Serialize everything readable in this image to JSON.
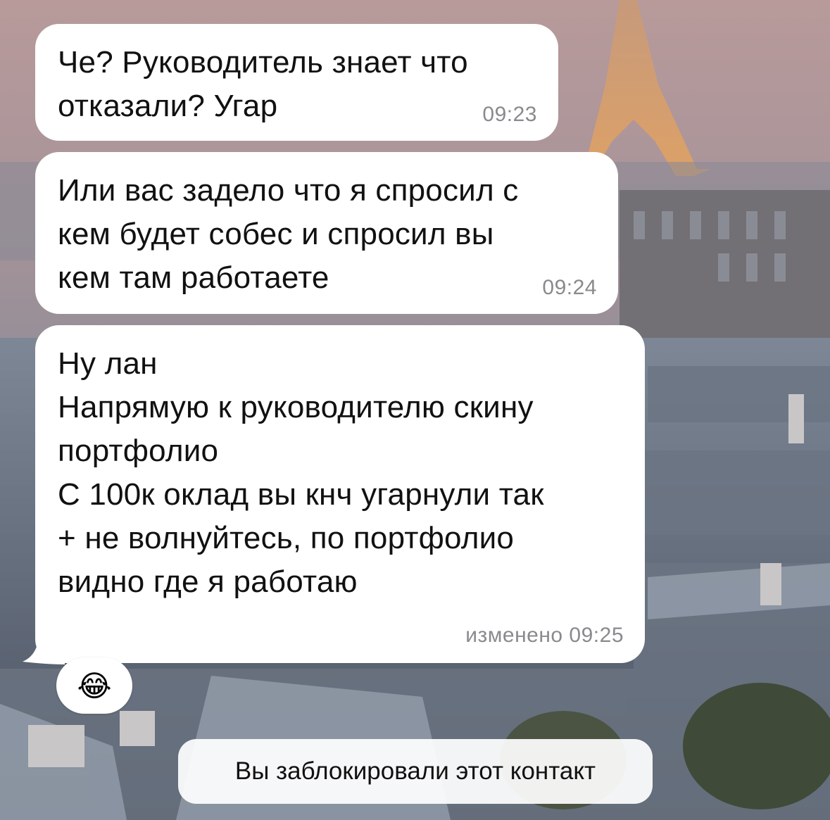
{
  "messages": [
    {
      "text": "Че? Руководитель знает что\nотказали? Угар",
      "time": "09:23"
    },
    {
      "text": "Или вас задело что я спросил с\nкем будет собес и спросил вы\nкем там работаете",
      "time": "09:24"
    },
    {
      "text": "Ну лан\nНапрямую к руководителю скину\nпортфолио\nС 100к оклад вы кнч угарнули так\n+ не волнуйтесь, по портфолио\nвидно где я работаю",
      "time": "изменено 09:25",
      "reaction": "😂",
      "reaction_icon": "face-with-tears-of-joy-icon"
    }
  ],
  "service_message": "Вы заблокировали этот контакт",
  "colors": {
    "bubble": "#ffffff",
    "text": "#111111",
    "time": "#8a8a8e"
  }
}
